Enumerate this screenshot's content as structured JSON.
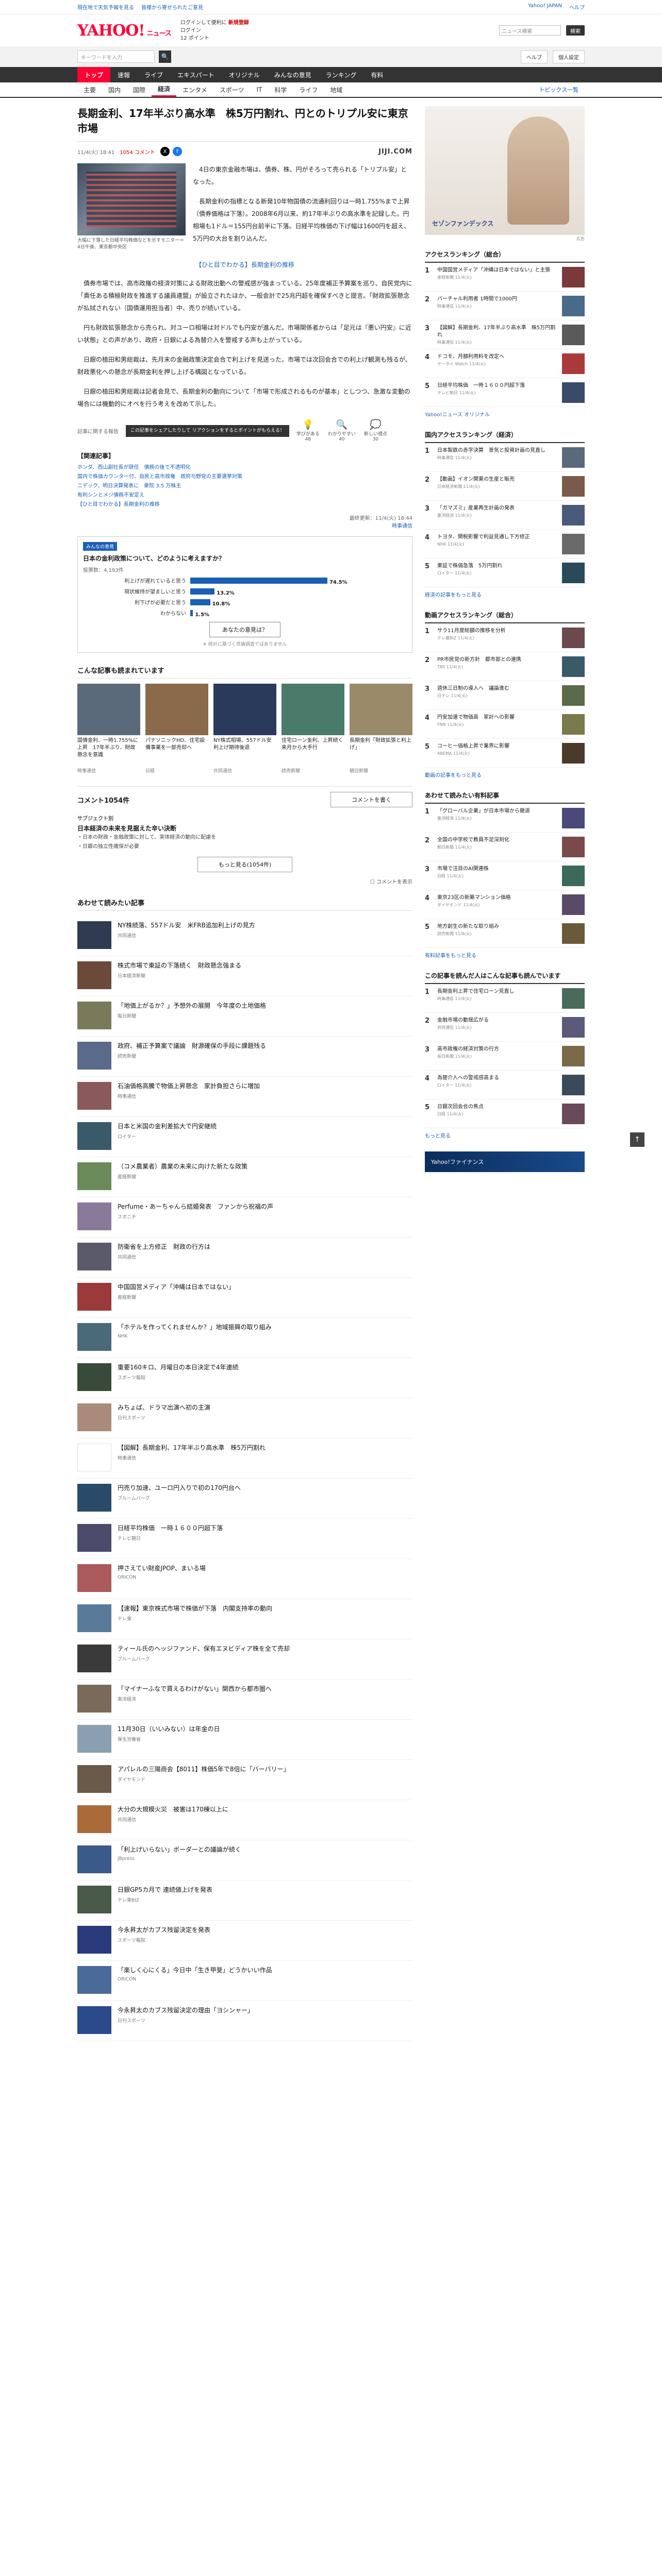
{
  "topbar": {
    "links": [
      "Yahoo! JAPAN",
      "ヘルプ"
    ],
    "left": [
      "現在地で天気予報を見る",
      "皆様から寄せられたご意見"
    ]
  },
  "brand": {
    "logo": "YAHOO!",
    "logo_sub": "JAPAN",
    "news": "ニュース",
    "line1": "ログインして便利に",
    "line1_b": "新規登録",
    "line2": "ログイン",
    "line3": "12 ポイント",
    "search_placeholder": "ニュース検索",
    "btn": "検索"
  },
  "searchbar": {
    "placeholder": "キーワードを入力",
    "go": "🔍",
    "right": [
      "ヘルプ",
      "個人設定"
    ]
  },
  "gnav": [
    "トップ",
    "速報",
    "ライブ",
    "エキスパート",
    "オリジナル",
    "みんなの意見",
    "ランキング",
    "有料"
  ],
  "subnav": [
    "主要",
    "国内",
    "国際",
    "経済",
    "エンタメ",
    "スポーツ",
    "IT",
    "科学",
    "ライフ",
    "地域"
  ],
  "subnav_more": "トピックス一覧",
  "article": {
    "title": "長期金利、17年半ぶり高水準　株5万円割れ、円とのトリプル安に東京市場",
    "date": "11/4(火) 18:41",
    "comments_label": "コメント",
    "comments": "1054",
    "provider": "JIJI.COM",
    "photo_caption": "大幅に下落した日経平均株価などを示すモニター＝4日午後、東京都中央区",
    "paras": [
      "4日の東京金融市場は、債券、株、円がそろって売られる「トリプル安」となった。",
      "長期金利の指標となる新発10年物国債の流通利回りは一時1.755%まで上昇（債券価格は下落）。2008年6月以来、約17年半ぶりの高水準を記録した。円相場も1ドル＝155円台前半に下落。日経平均株価の下げ幅は1600円を超え、5万円の大台を割り込んだ。",
      "債券市場では、高市政権の経済対策による財政出動への警戒感が強まっている。25年度補正予算案を巡り、自民党内に「責任ある積極財政を推進する議員連盟」が設立されたほか、一般会計で25兆円超を確保すべきと提言。「財政拡張懸念が払拭されない（国債運用担当者）中、売りが続いている。",
      "円も財政拡張懸念から売られ、対ユーロ相場は対ドルでも円安が進んだ。市場関係者からは「足元は『悪い円安』に近い状態」との声があり、政府・日銀による為替介入を警戒する声も上がっている。"
    ],
    "midhead": "【ひと目でわかる】長期金利の推移",
    "paras2": [
      "日銀の植田和男総裁は、先月末の金融政策決定会合で利上げを見送った。市場では次回会合での利上げ観測も残るが、財政悪化への懸念が長期金利を押し上げる構図となっている。",
      "日銀の植田和男総裁は記者会見で、長期金利の動向について「市場で形成されるものが基本」としつつ、急激な変動の場合には機動的にオペを行う考えを改めて示した。"
    ],
    "react_hint": "記事に関する報告",
    "react_tip": "この記事をシェアしたりして\nリアクションをするとポイントがもらえる！",
    "reacts": [
      {
        "ic": "💡",
        "lb": "学びがある",
        "n": "48"
      },
      {
        "ic": "🔍",
        "lb": "わかりやすい",
        "n": "40"
      },
      {
        "ic": "💭",
        "lb": "新しい視点",
        "n": "30"
      }
    ],
    "related_head": "【関連記事】",
    "related": [
      "ホンダ、西山副社長が辞任　債務の後で不透明化",
      "国内で株価カウンター付、自民と高市政権　政府与野党の主要選挙対策",
      "ニデック、明日決算発表に　衆院 3.5 万株主",
      "有利シンとメジ債務不安定え",
      "【ひと目でわかる】長期金利の推移"
    ],
    "stamp": "最終更新：11/4(火) 18:44",
    "stamp_src": "時事通信"
  },
  "poll": {
    "tag": "みんなの意見",
    "q": "日本の金利政策について、どのように考えますか？",
    "total": "投票数：4,193件",
    "rows": [
      {
        "label": "利上げが遅れていると思う",
        "pct": 74.5
      },
      {
        "label": "現状維持が望ましいと思う",
        "pct": 13.2
      },
      {
        "label": "利下げが必要だと思う",
        "pct": 10.8
      },
      {
        "label": "わからない",
        "pct": 1.5
      }
    ],
    "more": "あなたの意見は？",
    "note": "※ 統計に基づく世論調査ではありません"
  },
  "reco": {
    "title": "こんな記事も読まれています",
    "cards": [
      {
        "t": "国債金利、一時1.755%に上昇　17年半ぶり、財政懸念を意識",
        "s": "時事通信",
        "c": "#5a6a7a"
      },
      {
        "t": "パナソニックHD、住宅設備事業を一部売却へ",
        "s": "日経",
        "c": "#8a6a4a"
      },
      {
        "t": "NY株式相場、557ドル安　利上げ期待後退",
        "s": "共同通信",
        "c": "#2a3a5a"
      },
      {
        "t": "住宅ローン金利、上昇続く　来月から大手行",
        "s": "読売新聞",
        "c": "#4a7a6a"
      },
      {
        "t": "長期金利「財政拡張と利上げ」",
        "s": "朝日新聞",
        "c": "#9a8a6a"
      }
    ]
  },
  "comments": {
    "count": "コメント1054件",
    "write": "コメントを書く",
    "ex_h": "サブジェクト別",
    "ex_title": "日本経済の未来を見据えた辛い決断",
    "ex_items": [
      "・日本の財政・金融政策に対して、実体経済の動向に配慮を",
      "・日銀の独立性確保が必要"
    ],
    "more": "もっと見る(1054件)",
    "hide": "コメントを表示"
  },
  "feed": {
    "title": "あわせて読みたい記事",
    "items": [
      {
        "t": "NY株続落、557ドル安　米FRB追加利上げの見方",
        "s": "共同通信",
        "c": "#2e3b50"
      },
      {
        "t": "株式市場で東証の下落続く　財政懸念強まる",
        "s": "日本経済新聞",
        "c": "#6b4a3a"
      },
      {
        "t": "「地価上がるか？」予想外の展開　今年度の土地価格",
        "s": "毎日新聞",
        "c": "#7a7a5a"
      },
      {
        "t": "政府、補正予算案で議論　財源確保の手段に課題残る",
        "s": "読売新聞",
        "c": "#5a6a8a"
      },
      {
        "t": "石油価格高騰で物価上昇懸念　家計負担さらに増加",
        "s": "時事通信",
        "c": "#8a5a5a"
      },
      {
        "t": "日本と米国の金利差拡大で円安継続",
        "s": "ロイター",
        "c": "#3a5a6a"
      },
      {
        "t": "（コメ農業者）農業の未来に向けた新たな政策",
        "s": "産経新聞",
        "c": "#6a8a5a"
      },
      {
        "t": "Perfume・あーちゃんら結婚発表　ファンから祝福の声",
        "s": "スポニチ",
        "c": "#8a7a9a"
      },
      {
        "t": "防衛省を上方修正　財政の行方は",
        "s": "共同通信",
        "c": "#5a5a6a"
      },
      {
        "t": "中国国営メディア「沖縄は日本ではない」",
        "s": "産経新聞",
        "c": "#9a3a3a"
      },
      {
        "t": "「ホテルを作ってくれませんか？」地域振興の取り組み",
        "s": "NHK",
        "c": "#4a6a7a"
      },
      {
        "t": "重要160キロ、月曜日の本日決定で4年連続",
        "s": "スポーツ報知",
        "c": "#3a4a3a"
      },
      {
        "t": "みちょぱ、ドラマ出演へ初の主演",
        "s": "日刊スポーツ",
        "c": "#aa8a7a"
      },
      {
        "t": "【図解】長期金利、17年半ぶり高水準　株5万円割れ",
        "s": "時事通信",
        "c": "#ffffff"
      },
      {
        "t": "円売り加速、ユーロ円入りで初の170円台へ",
        "s": "ブルームバーグ",
        "c": "#2a4a6a"
      },
      {
        "t": "日経平均株価　一時１６００円超下落",
        "s": "テレビ朝日",
        "c": "#4a4a6a"
      },
      {
        "t": "押さえてい財産JPOP、まいる場",
        "s": "ORICON",
        "c": "#aa5a5a"
      },
      {
        "t": "【速報】東京株式市場で株価が下落　内閣支持率の動向",
        "s": "テレ東",
        "c": "#5a7a9a"
      },
      {
        "t": "ティール氏のヘッジファンド、保有エヌビディア株を全て売却",
        "s": "ブルームバーグ",
        "c": "#3a3a3a"
      },
      {
        "t": "「マイナーふなで買えるわけがない」関西から都市圏へ",
        "s": "東洋経済",
        "c": "#7a6a5a"
      },
      {
        "t": "11月30日（いいみない）は年金の日",
        "s": "厚生労働省",
        "c": "#8aa0b0"
      },
      {
        "t": "アパレルの三陽商会【8011】株価5年で8倍に「バーバリー」",
        "s": "ダイヤモンド",
        "c": "#6a5a4a"
      },
      {
        "t": "大分の大規模火災　被害は170棟以上に",
        "s": "共同通信",
        "c": "#aa6a3a"
      },
      {
        "t": "「利上げいらない」ボーダーとの議論が続く",
        "s": "JBpress",
        "c": "#3a5a8a"
      },
      {
        "t": "日銀GP5カ月で 連続値上げを発表",
        "s": "テレ東BIZ",
        "c": "#4a5a4a"
      },
      {
        "t": "今永昇太がカブス残留決定を発表",
        "s": "スポーツ報知",
        "c": "#2a3a7a"
      },
      {
        "t": "「楽しく心にくる」今日中「生き甲斐」どうかいい作品",
        "s": "ORICON",
        "c": "#4a6a9a"
      },
      {
        "t": "今永昇太のカブス残留決定の理由「ヨシンャー」",
        "s": "日刊スポーツ",
        "c": "#2a4a8a"
      }
    ]
  },
  "side": {
    "ad_text": "セゾンファンデックス",
    "ad_note": "広告",
    "rank1": {
      "title": "アクセスランキング（総合）",
      "items": [
        {
          "t": "中国国営メディア「沖縄は日本ではない」と主張",
          "s": "産経新聞 11/4(火)",
          "c": "#7a3a3a"
        },
        {
          "t": "バーチャル利用者 1時間で1000円",
          "s": "時事通信 11/4(火)",
          "c": "#4a6a8a"
        },
        {
          "t": "【図解】長期金利、17年半ぶり高水準　株5万円割れ",
          "s": "時事通信 11/4(火)",
          "c": "#5a5a5a"
        },
        {
          "t": "ドコモ、月額利用料を改定へ",
          "s": "ケータイ Watch 11/4(火)",
          "c": "#aa3a3a"
        },
        {
          "t": "日経平均株価　一時１６００円超下落",
          "s": "テレビ朝日 11/4(火)",
          "c": "#3a4a6a"
        }
      ],
      "more": "Yahoo!ニュース オリジナル"
    },
    "rank2": {
      "title": "国内アクセスランキング（経済）",
      "items": [
        {
          "t": "日本製鉄の赤字決算　景気と投資計画の見直し",
          "s": "時事通信 11/4(火)",
          "c": "#5a6a7a"
        },
        {
          "t": "【動画】イオン関東の生産と販売",
          "s": "日本経済新聞 11/4(火)",
          "c": "#7a5a4a"
        },
        {
          "t": "「ガマズミ」産業再生計画の発表",
          "s": "東洋経済 11/4(火)",
          "c": "#4a5a7a"
        },
        {
          "t": "トヨタ、関税影響で利益見通し下方修正",
          "s": "NHK 11/4(火)",
          "c": "#6a6a6a"
        },
        {
          "t": "東証で株価急落　5万円割れ",
          "s": "ロイター 11/4(火)",
          "c": "#2a4a5a"
        }
      ],
      "more": "経済の記事をもっと見る"
    },
    "rank3": {
      "title": "動画アクセスランキング（総合）",
      "items": [
        {
          "t": "サラ11月度総額の推移を分析",
          "s": "テレ東BIZ 11/4(火)",
          "c": "#6a4a4a"
        },
        {
          "t": "PR市民党の新方針　都市部との連携",
          "s": "TBS 11/4(火)",
          "c": "#3a5a6a"
        },
        {
          "t": "週休三日制の導入へ　議論進む",
          "s": "日テレ 11/4(火)",
          "c": "#5a6a4a"
        },
        {
          "t": "円安加速で物価高　家計への影響",
          "s": "FNN 11/4(火)",
          "c": "#7a7a4a"
        },
        {
          "t": "コーヒー価格上昇で業界に影響",
          "s": "ABEMA 11/4(火)",
          "c": "#4a3a2a"
        }
      ],
      "more": "動画の記事をもっと見る"
    },
    "rank4": {
      "title": "あわせて読みたい有料記事",
      "items": [
        {
          "t": "「グローバル企業」が日本市場から撤退",
          "s": "東洋経済 11/4(火)",
          "c": "#4a4a7a"
        },
        {
          "t": "全国の中学校で教員不足深刻化",
          "s": "朝日新聞 11/4(火)",
          "c": "#7a4a4a"
        },
        {
          "t": "市場で注目のAI関連株",
          "s": "日経 11/4(火)",
          "c": "#3a6a5a"
        },
        {
          "t": "東京23区の新築マンション価格",
          "s": "ダイヤモンド 11/4(火)",
          "c": "#5a4a6a"
        },
        {
          "t": "地方創生の新たな取り組み",
          "s": "読売新聞 11/4(火)",
          "c": "#6a5a3a"
        }
      ],
      "more": "有料記事をもっと見る"
    },
    "rank5": {
      "title": "この記事を読んだ人はこんな記事も読んでいます",
      "items": [
        {
          "t": "長期金利上昇で住宅ローン見直し",
          "s": "時事通信 11/4(火)",
          "c": "#4a6a5a"
        },
        {
          "t": "金融市場の動揺広がる",
          "s": "共同通信 11/4(火)",
          "c": "#5a5a7a"
        },
        {
          "t": "高市政権の経済対策の行方",
          "s": "毎日新聞 11/4(火)",
          "c": "#7a6a4a"
        },
        {
          "t": "為替介入への警戒感高まる",
          "s": "ロイター 11/4(火)",
          "c": "#3a4a5a"
        },
        {
          "t": "日銀次回会合の焦点",
          "s": "日経 11/4(火)",
          "c": "#6a4a5a"
        }
      ],
      "more": "もっと見る"
    },
    "banner": "Yahoo!ファイナンス"
  },
  "totop": "↑"
}
